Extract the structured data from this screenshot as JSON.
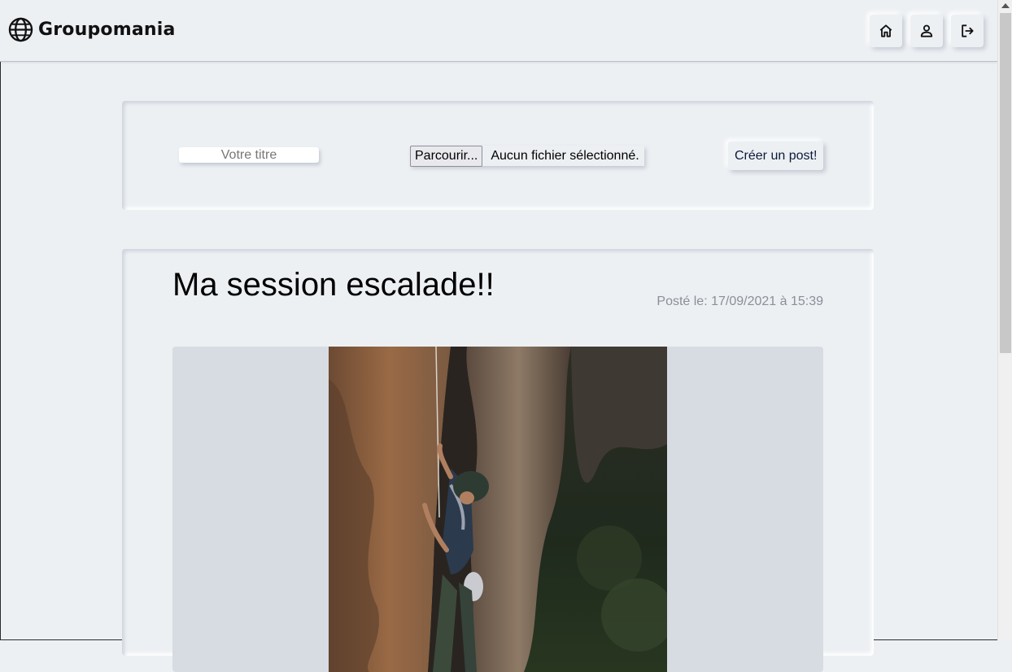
{
  "header": {
    "brand": "Groupomania",
    "logo_icon": "globe-icon",
    "nav": [
      {
        "name": "home",
        "icon": "home-icon"
      },
      {
        "name": "profile",
        "icon": "user-icon"
      },
      {
        "name": "logout",
        "icon": "logout-icon"
      }
    ]
  },
  "create_post": {
    "title_placeholder": "Votre titre",
    "title_value": "",
    "browse_label": "Parcourir...",
    "file_status": "Aucun fichier sélectionné.",
    "submit_label": "Créer un post!"
  },
  "post": {
    "title": "Ma session escalade!!",
    "date": "Posté le: 17/09/2021 à 15:39",
    "image_alt": "climber on rock wall"
  },
  "colors": {
    "background": "#edf0f3",
    "media_background": "#d7dbe2",
    "date_text": "#8a8f99"
  }
}
